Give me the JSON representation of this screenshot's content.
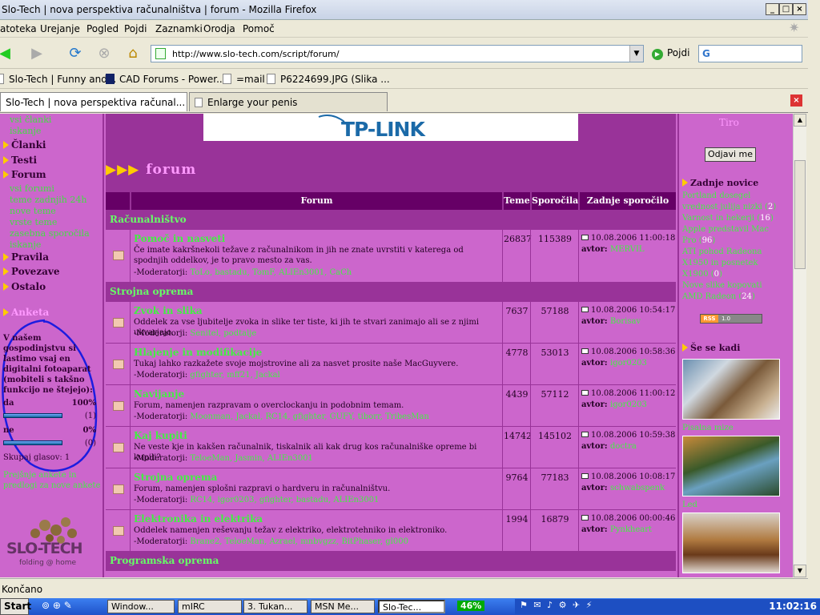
{
  "window": {
    "title": "Slo-Tech | nova perspektiva računalništva | forum - Mozilla Firefox"
  },
  "menu": [
    "Datoteka",
    "Urejanje",
    "Pogled",
    "Pojdi",
    "Zaznamki",
    "Orodja",
    "Pomoč"
  ],
  "menu_visible": [
    "atoteka",
    "Urejanje",
    "Pogled",
    "Pojdi",
    "Zaznamki",
    "Orodja",
    "Pomoč"
  ],
  "navbar": {
    "url": "http://www.slo-tech.com/script/forum/",
    "go_label": "Pojdi"
  },
  "bookmarks": [
    "Slo-Tech | Funny and...",
    "CAD Forums - Power...",
    "=mail",
    "P6224699.JPG (Slika ..."
  ],
  "tabs": [
    {
      "label": "Slo-Tech | nova perspektiva računal...",
      "active": true
    },
    {
      "label": "Enlarge your penis",
      "active": false
    }
  ],
  "left": {
    "top_links": [
      "vsi članki",
      "iskanje"
    ],
    "nav": [
      {
        "label": "Članki"
      },
      {
        "label": "Testi"
      },
      {
        "label": "Forum"
      }
    ],
    "forum_sub": [
      "vsi forumi",
      "teme zadnjih 24h",
      "nove teme",
      "vrste teme",
      "zasebna sporočila",
      "iskanje"
    ],
    "nav2": [
      {
        "label": "Pravila"
      },
      {
        "label": "Povezave"
      },
      {
        "label": "Ostalo"
      }
    ],
    "poll_heading": "Anketa",
    "poll_question": "V našem gospodinjstvu si lastimo vsaj en digitalni fotoaparat (mobiteli s takšno funkcijo ne štejejo):",
    "poll": [
      {
        "label": "da",
        "pct": "100%",
        "count": "(1)",
        "fill": 1.0
      },
      {
        "label": "ne",
        "pct": "0%",
        "count": "(0)",
        "fill": 1.0
      }
    ],
    "poll_total": "Skupaj glasov: 1",
    "poll_links": "Prejšnje ankete in predlogi za nove ankete",
    "logo_text": "SLO-TECH",
    "logo_sub": "folding @ home"
  },
  "banner": {
    "text": "TP-LINK"
  },
  "forum": {
    "heading": "forum",
    "headers": {
      "forum": "Forum",
      "teme": "Teme",
      "sporocila": "Sporočila",
      "zadnje": "Zadnje sporočilo"
    },
    "categories": [
      {
        "name": "Računalništvo"
      },
      {
        "name": "Strojna oprema"
      },
      {
        "name": "Programska oprema"
      }
    ],
    "rows": [
      {
        "name": "Pomoč in nasveti",
        "desc": "Če imate kakršnekoli težave z računalnikom in jih ne znate uvrstiti v katerega od spodnjih oddelkov, je to pravo mesto za vas.",
        "mods": "-Moderatorji: ",
        "mod_names": "ToLo, bastadu, TomF, ALIEn3001, CaCh",
        "teme": "26837",
        "sporocila": "115389",
        "date": "10.08.2006 11:00:18",
        "author_label": "avtor: ",
        "author": "MERVIL"
      },
      {
        "name": "Zvok in slika",
        "desc": "Oddelek za vse ljubitelje zvoka in slike ter tiste, ki jih te stvari zanimajo ali se z njimi ukvarjajo.",
        "mods": "-Moderatorji: ",
        "mod_names": "Senitel, podtalje",
        "teme": "7637",
        "sporocila": "57188",
        "date": "10.08.2006 10:54:17",
        "author_label": "avtor: ",
        "author": "Borisav"
      },
      {
        "name": "Hlajenje in modifikacije",
        "desc": "Tukaj lahko razkažete svoje mojstrovine ali za nasvet prosite naše MacGuyvere.",
        "mods": "-Moderatorji: ",
        "mod_names": "gfighter, mff21, Jackal",
        "teme": "4778",
        "sporocila": "53013",
        "date": "10.08.2006 10:58:36",
        "author_label": "avtor: ",
        "author": "igor0203"
      },
      {
        "name": "Navijanje",
        "desc": "Forum, namenjen razpravam o overclockanju in podobnim temam.",
        "mods": "-Moderatorji: ",
        "mod_names": "Moonman, Jackal, RC14, gfighter, GUFY, tiborr, TribesMan",
        "teme": "4439",
        "sporocila": "57112",
        "date": "10.08.2006 11:00:12",
        "author_label": "avtor: ",
        "author": "igor0203"
      },
      {
        "name": "Kaj kupiti",
        "desc": "Ne veste kje in kakšen računalnik, tiskalnik ali kak drug kos računalniške opreme bi kupili?",
        "mods": "-Moderatorji: ",
        "mod_names": "TeloeMan, Jasmin, ALIEn3001",
        "teme": "14742",
        "sporocila": "145102",
        "date": "10.08.2006 10:59:38",
        "author_label": "avtor: ",
        "author": "doctra"
      },
      {
        "name": "Strojna oprema",
        "desc": "Forum, namenjen splošni razpravi o hardveru in računalništvu.",
        "mods": "-Moderatorji: ",
        "mod_names": "RC14, igor0203, gfighter, bastadu, ALIEn3001",
        "teme": "9764",
        "sporocila": "77183",
        "date": "10.08.2006 10:08:17",
        "author_label": "avtor: ",
        "author": "schwabspenk"
      },
      {
        "name": "Elektronika in elektrika",
        "desc": "Oddelek namenjen reševanju težav z elektriko, elektrotehniko in elektroniko.",
        "mods": "-Moderatorji: ",
        "mod_names": "Brane2, TeloeMan, Azrael, mnbvgzz, BitPhaser, gl000",
        "teme": "1994",
        "sporocila": "16879",
        "date": "10.08.2006 00:00:46",
        "author_label": "avtor: ",
        "author": "Pynkheart"
      }
    ]
  },
  "right": {
    "user": "Tiro",
    "logout": "Odjavi me",
    "news_heading": "Zadnje novice",
    "news": [
      {
        "title": "Portland dosegel vrednost julija nizki",
        "count": "2"
      },
      {
        "title": "Varnost in hekerji",
        "count": "16"
      },
      {
        "title": "Apple predstavil Mac Pro",
        "count": "96"
      },
      {
        "title": "ATI pohod Radeona X1950 in posnetek X1900",
        "count": "0"
      },
      {
        "title": "Nove slike kopovati AMD Radeon",
        "count": "24"
      }
    ],
    "rss": {
      "left": "RSS",
      "right": "1.0"
    },
    "where_heading": "Še se kadi",
    "photo_captions": [
      "Pisalna mize",
      "Led"
    ]
  },
  "status": {
    "text": "Končano"
  },
  "taskbar": {
    "start": "Start",
    "items": [
      "Window...",
      "mIRC",
      "3. Tukan...",
      "MSN Me...",
      "Slo-Tec..."
    ],
    "cpu": "46%",
    "clock": "11:02:16"
  }
}
